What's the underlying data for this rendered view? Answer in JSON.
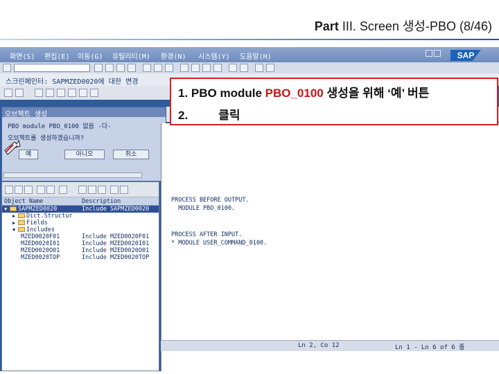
{
  "slide": {
    "title_part": "Part",
    "title_rest": "III. Screen 생성-PBO (8/46)"
  },
  "sap": {
    "menu": [
      "화면(S)",
      "편집(E)",
      "이동(G)",
      "유틸리티(M)",
      "환경(N)",
      "시스템(Y)",
      "도움말(H)"
    ],
    "logo": "SAP",
    "screen_title": "스크린페인터: SAPMZED0020에 대한 변경",
    "popup": {
      "title": "오브젝트 생성",
      "message_line1": "PBO module PBO_0100 없음 -다-",
      "message_line2": "오브젝트를 생성하겠습니까?",
      "yes_label": "예",
      "no_label": "아니오",
      "cancel_label": "취소"
    },
    "tree": {
      "col_name": "Object Name",
      "col_desc": "Description",
      "rows": [
        {
          "name": "SAPMZED0020",
          "desc": "Include SAPMZED0020",
          "type": "folder-open",
          "level": 0,
          "selected": true
        },
        {
          "name": "Dict.Structur",
          "desc": "",
          "type": "folder",
          "level": 1,
          "selected": false
        },
        {
          "name": "Fields",
          "desc": "",
          "type": "folder",
          "level": 1,
          "selected": false
        },
        {
          "name": "Includes",
          "desc": "",
          "type": "folder-open",
          "level": 1,
          "selected": false
        },
        {
          "name": "MZED0020F01",
          "desc": "Include MZED0020F01",
          "type": "item",
          "level": 2,
          "selected": false
        },
        {
          "name": "MZED0020I01",
          "desc": "Include MZED0020I01",
          "type": "item",
          "level": 2,
          "selected": false
        },
        {
          "name": "MZED0020O01",
          "desc": "Include MZED0020O01",
          "type": "item",
          "level": 2,
          "selected": false
        },
        {
          "name": "MZED0020TOP",
          "desc": "Include MZED0020TOP",
          "type": "item",
          "level": 2,
          "selected": false
        }
      ]
    },
    "code": {
      "line1": "PROCESS BEFORE OUTPUT.",
      "line2": "  MODULE PBO_0100.",
      "line3": "PROCESS AFTER INPUT.",
      "line4": "* MODULE USER_COMMAND_0100."
    },
    "status": {
      "position": "Ln  2, Co 12",
      "range": "Ln  1 - Ln  6 of  6 줄"
    }
  },
  "callout": {
    "line1_prefix": "1. PBO module ",
    "line1_highlight": "PBO_0100",
    "line1_suffix": " 생성을 위해 ‘예’ 버튼",
    "line2_num": "2.",
    "line2_text": "클릭"
  },
  "colors": {
    "callout_border": "#d81e1e",
    "highlight": "#c81414",
    "sap_bg": "#2f5b9b"
  }
}
